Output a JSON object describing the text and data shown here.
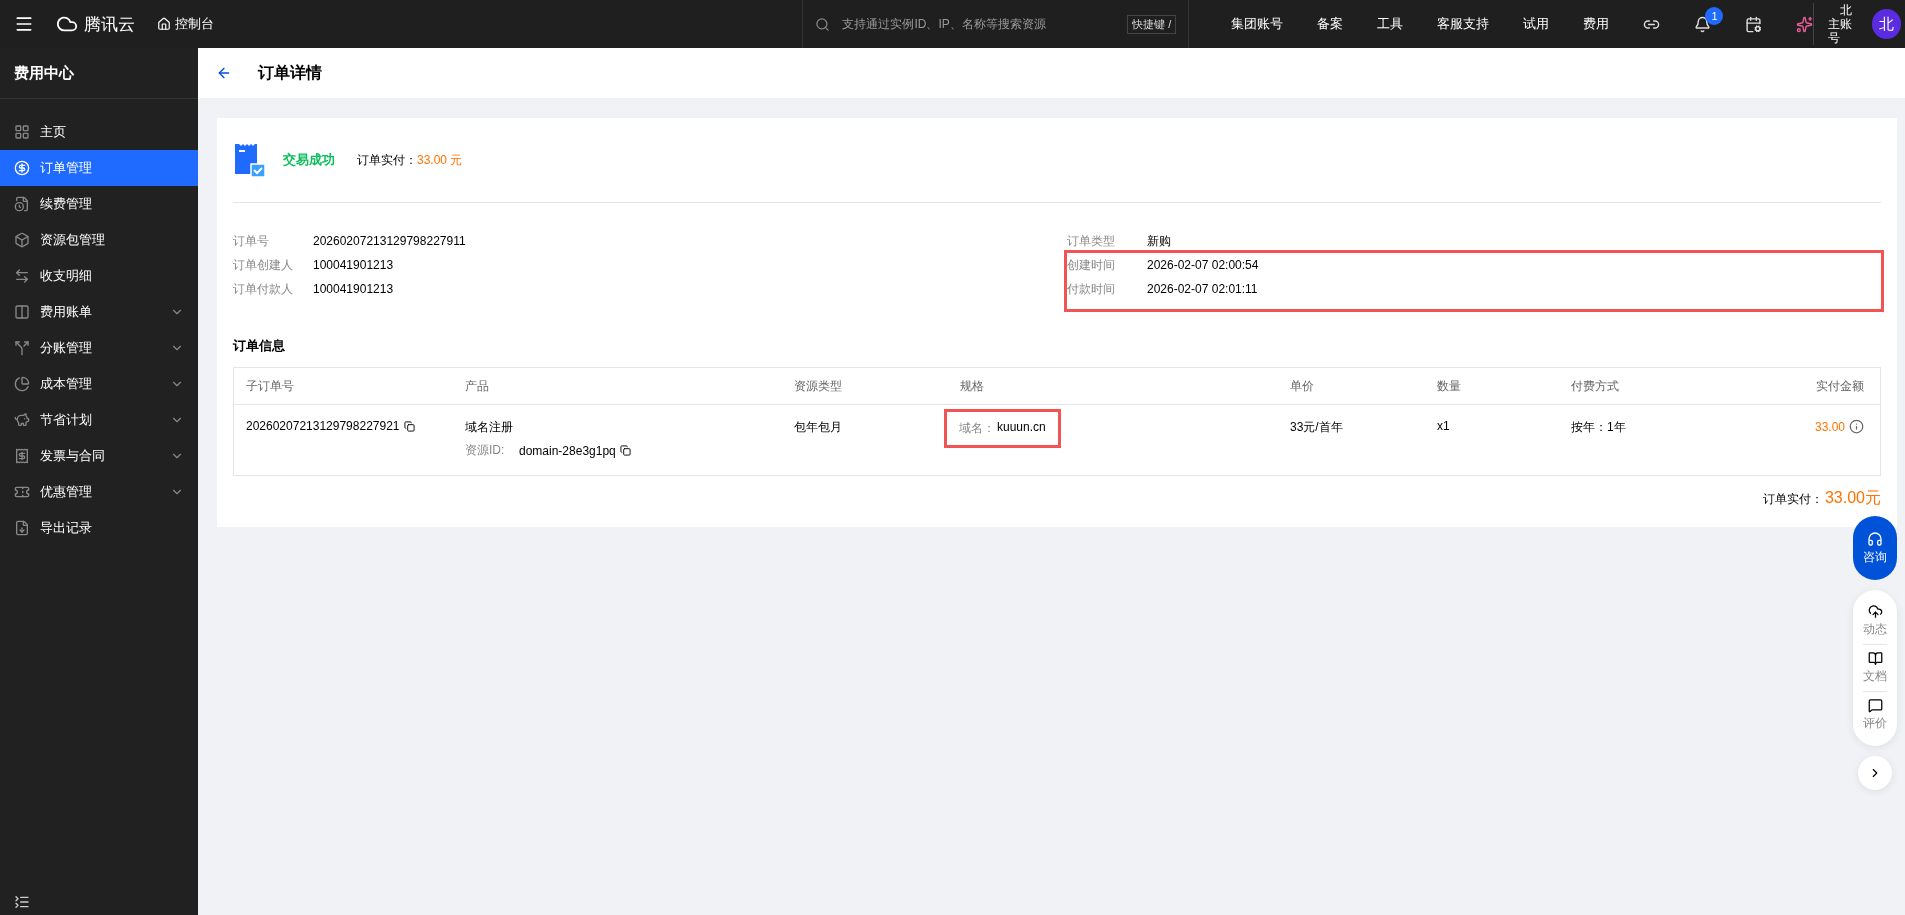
{
  "topbar": {
    "brand": "腾讯云",
    "console": "控制台",
    "search": {
      "placeholder": "支持通过实例ID、IP、名称等搜索资源"
    },
    "shortcut": "快捷键 /",
    "links": [
      "集团账号",
      "备案",
      "工具",
      "客服支持",
      "试用",
      "费用"
    ],
    "notifications": "1",
    "account": {
      "name": "北",
      "role": "主账号",
      "avatar": "北"
    }
  },
  "sidebar": {
    "title": "费用中心",
    "items": [
      {
        "label": "主页",
        "selected": false,
        "expandable": false
      },
      {
        "label": "订单管理",
        "selected": true,
        "expandable": false
      },
      {
        "label": "续费管理",
        "selected": false,
        "expandable": false
      },
      {
        "label": "资源包管理",
        "selected": false,
        "expandable": false
      },
      {
        "label": "收支明细",
        "selected": false,
        "expandable": false
      },
      {
        "label": "费用账单",
        "selected": false,
        "expandable": true
      },
      {
        "label": "分账管理",
        "selected": false,
        "expandable": true
      },
      {
        "label": "成本管理",
        "selected": false,
        "expandable": true
      },
      {
        "label": "节省计划",
        "selected": false,
        "expandable": true
      },
      {
        "label": "发票与合同",
        "selected": false,
        "expandable": true
      },
      {
        "label": "优惠管理",
        "selected": false,
        "expandable": true
      },
      {
        "label": "导出记录",
        "selected": false,
        "expandable": false
      }
    ]
  },
  "page": {
    "title": "订单详情"
  },
  "status": {
    "text": "交易成功",
    "paid_label": "订单实付：",
    "paid_value": "33.00 元"
  },
  "details": {
    "left": [
      {
        "label": "订单号",
        "value": "20260207213129798227911",
        "highlighted": false
      },
      {
        "label": "订单创建人",
        "value": "100041901213",
        "highlighted": false
      },
      {
        "label": "订单付款人",
        "value": "100041901213",
        "highlighted": false
      }
    ],
    "right": [
      {
        "label": "订单类型",
        "value": "新购",
        "highlighted": false
      },
      {
        "label": "创建时间",
        "value": "2026-02-07 02:00:54",
        "highlighted": true
      },
      {
        "label": "付款时间",
        "value": "2026-02-07 02:01:11",
        "highlighted": true
      }
    ]
  },
  "order_info": {
    "title": "订单信息",
    "columns": [
      "子订单号",
      "产品",
      "资源类型",
      "规格",
      "单价",
      "数量",
      "付费方式",
      "实付金额"
    ],
    "rows": [
      {
        "sub_order": "20260207213129798227921",
        "product": "域名注册",
        "resource_label": "资源ID:",
        "resource_id": "domain-28e3g1pq",
        "resource_type": "包年包月",
        "spec_label": "域名：",
        "spec_value": "kuuun.cn",
        "spec_highlighted": true,
        "unit_price": "33元/首年",
        "quantity": "x1",
        "billing": "按年：1年",
        "amount": "33.00"
      }
    ],
    "total_label": "订单实付：",
    "total_value": "33.00元"
  },
  "float": {
    "consult": "咨询",
    "items": [
      "动态",
      "文档",
      "评价"
    ]
  }
}
